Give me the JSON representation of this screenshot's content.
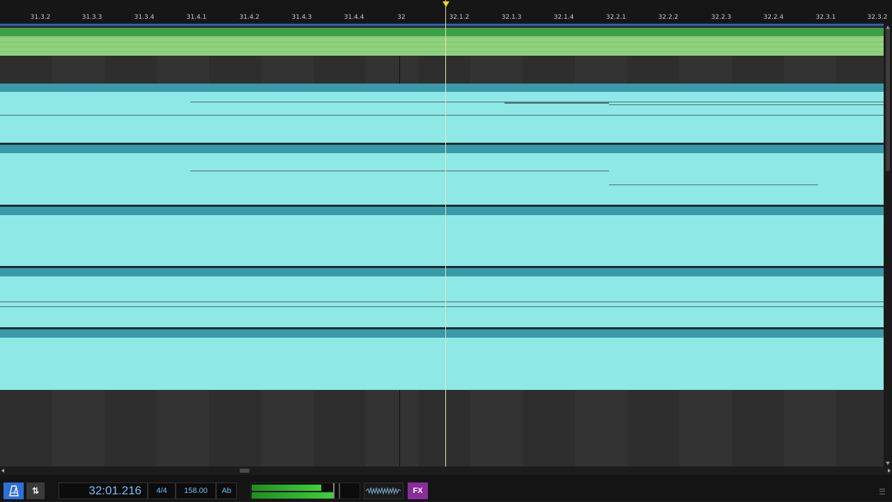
{
  "ruler": {
    "ticks": [
      "31.3.2",
      "31.3.3",
      "31.3.4",
      "31.4.1",
      "31.4.2",
      "31.4.3",
      "31.4.4",
      "32",
      "32.1.2",
      "32.1.3",
      "32.1.4",
      "32.2.1",
      "32.2.2",
      "32.2.3",
      "32.2.4",
      "32.3.1",
      "32.3.2"
    ]
  },
  "transport": {
    "time": "32:01.216",
    "signature": "4/4",
    "tempo": "158.00",
    "key": "Ab",
    "fx_label": "FX",
    "arrange_icon": "⇅"
  },
  "icons": {
    "metronome": "metronome-icon",
    "waveform": "waveform-icon",
    "menu": "menu-icon"
  },
  "colors": {
    "accent": "#2f6fd8",
    "fx": "#8a2d9c",
    "track_green": "#8fd17f",
    "track_cyan": "#8ee8e6",
    "time_text": "#79bff5"
  }
}
